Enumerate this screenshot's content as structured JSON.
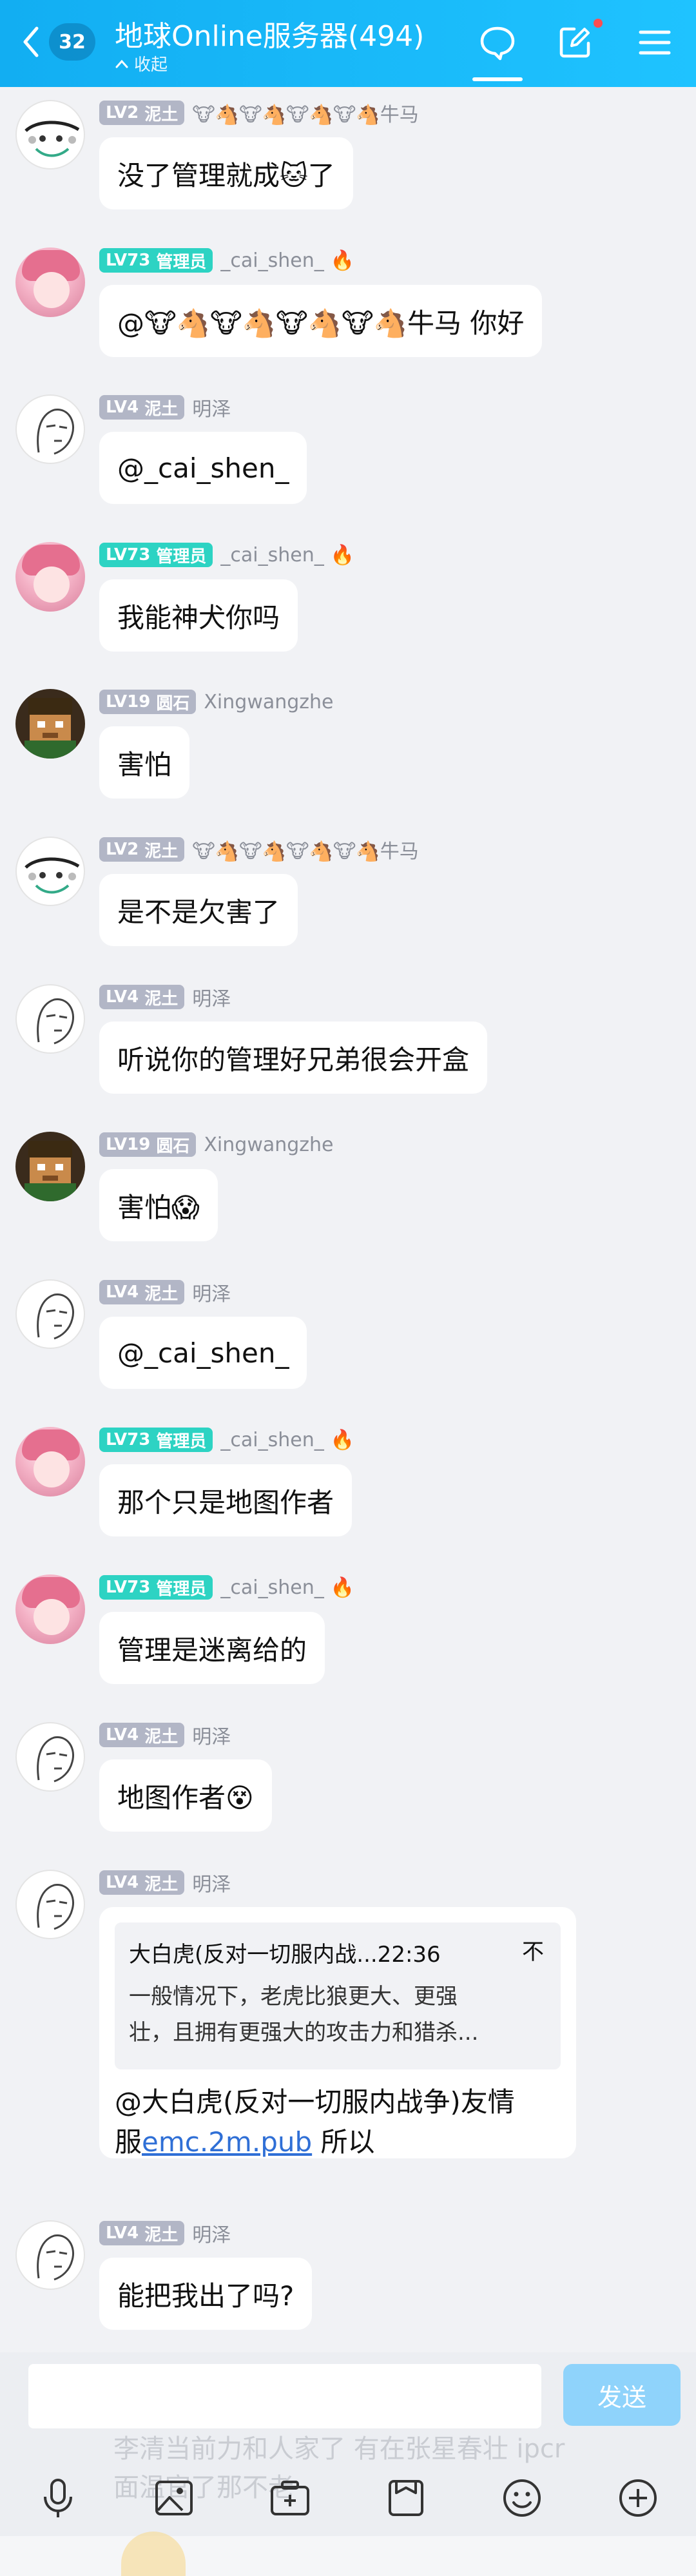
{
  "header": {
    "back_count": "32",
    "title": "地球Online服务器(494)",
    "collapse_label": "收起"
  },
  "messages": [
    {
      "level": "LV2",
      "rank": "泥土",
      "nick": "🐮🐴🐮🐴🐮🐴🐮🐴牛马",
      "text": "没了管理就成🐱了"
    },
    {
      "level": "LV73",
      "rank": "管理员",
      "nick": "_cai_shen_",
      "fire": "🔥",
      "text": "@🐮🐴🐮🐴🐮🐴🐮🐴牛马 你好"
    },
    {
      "level": "LV4",
      "rank": "泥土",
      "nick": "明泽",
      "text": "@_cai_shen_"
    },
    {
      "level": "LV73",
      "rank": "管理员",
      "nick": "_cai_shen_",
      "fire": "🔥",
      "text": "我能神犬你吗"
    },
    {
      "level": "LV19",
      "rank": "圆石",
      "nick": "Xingwangzhe",
      "text": "害怕"
    },
    {
      "level": "LV2",
      "rank": "泥土",
      "nick": "🐮🐴🐮🐴🐮🐴🐮🐴牛马",
      "text": "是不是欠害了"
    },
    {
      "level": "LV4",
      "rank": "泥土",
      "nick": "明泽",
      "text": "听说你的管理好兄弟很会开盒"
    },
    {
      "level": "LV19",
      "rank": "圆石",
      "nick": "Xingwangzhe",
      "text": "害怕😱"
    },
    {
      "level": "LV4",
      "rank": "泥土",
      "nick": "明泽",
      "text": "@_cai_shen_"
    },
    {
      "level": "LV73",
      "rank": "管理员",
      "nick": "_cai_shen_",
      "fire": "🔥",
      "text": "那个只是地图作者"
    },
    {
      "level": "LV73",
      "rank": "管理员",
      "nick": "_cai_shen_",
      "fire": "🔥",
      "text": "管理是迷离给的"
    },
    {
      "level": "LV4",
      "rank": "泥土",
      "nick": "明泽",
      "text": "地图作者😵"
    },
    {
      "level": "LV4",
      "rank": "泥土",
      "nick": "明泽",
      "quote_head": "大白虎(反对一切服内战...22:36",
      "quote_close": "不",
      "quote_line1": "一般情况下，老虎比狼更大、更强",
      "quote_line2": "壮，且拥有更强大的攻击力和猎杀...",
      "text_part1": "@大白虎(反对一切服内战争)友情",
      "text_part2": "服",
      "link": "emc.2m.pub",
      "text_part3": " 所以"
    },
    {
      "level": "LV4",
      "rank": "泥土",
      "nick": "明泽",
      "text": "能把我出了吗?"
    }
  ],
  "input": {
    "send_label": "发送",
    "ghost_text": "李清当前力和人家了 有在张星春壮 ipcr 面温官了那不老"
  },
  "toolbar": {
    "icons": [
      "microphone-icon",
      "image-icon",
      "camera-icon",
      "file-icon",
      "emoji-icon",
      "plus-icon"
    ]
  }
}
